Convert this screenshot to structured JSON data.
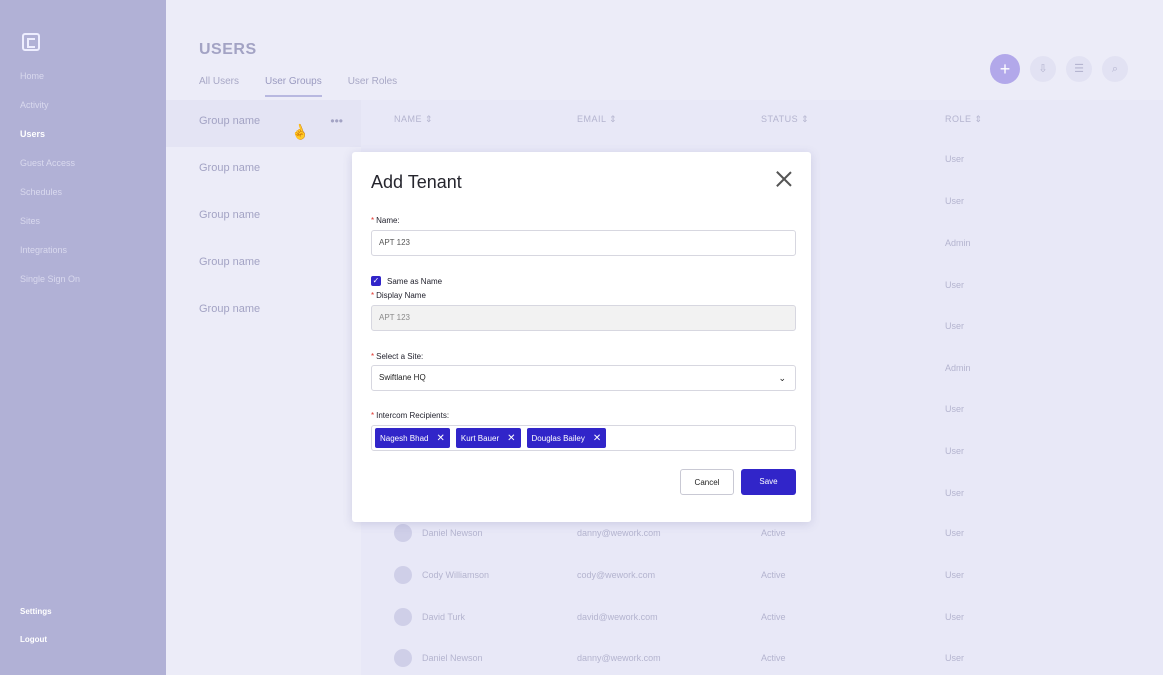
{
  "sidebar": {
    "items": [
      {
        "label": "Home"
      },
      {
        "label": "Activity"
      },
      {
        "label": "Users"
      },
      {
        "label": "Guest Access"
      },
      {
        "label": "Schedules"
      },
      {
        "label": "Sites"
      },
      {
        "label": "Integrations"
      },
      {
        "label": "Single Sign On"
      }
    ],
    "bottom": [
      {
        "label": "Settings"
      },
      {
        "label": "Logout"
      }
    ]
  },
  "page": {
    "title": "USERS",
    "tabs": [
      {
        "label": "All Users"
      },
      {
        "label": "User Groups"
      },
      {
        "label": "User Roles"
      }
    ],
    "actions": {
      "add": "+",
      "download": "⇩",
      "grid": "☰",
      "search": "⌕"
    }
  },
  "groups": [
    {
      "label": "Group name",
      "menu": "•••"
    },
    {
      "label": "Group name"
    },
    {
      "label": "Group name"
    },
    {
      "label": "Group name"
    },
    {
      "label": "Group name"
    }
  ],
  "table": {
    "headers": {
      "name": "NAME ⇕",
      "email": "EMAIL ⇕",
      "status": "STATUS ⇕",
      "role": "ROLE ⇕"
    },
    "roles": [
      "User",
      "User",
      "Admin",
      "User",
      "User",
      "Admin",
      "User",
      "User",
      "User"
    ],
    "rows": [
      {
        "name": "Daniel Newson",
        "email": "danny@wework.com",
        "status": "Active",
        "role": "User"
      },
      {
        "name": "Cody Williamson",
        "email": "cody@wework.com",
        "status": "Active",
        "role": "User"
      },
      {
        "name": "David Turk",
        "email": "david@wework.com",
        "status": "Active",
        "role": "User"
      },
      {
        "name": "Daniel Newson",
        "email": "danny@wework.com",
        "status": "Active",
        "role": "User"
      }
    ]
  },
  "modal": {
    "title": "Add Tenant",
    "name_label": "Name:",
    "name_value": "APT 123",
    "same_as_name_label": "Same as Name",
    "display_name_label": "Display Name",
    "display_name_value": "APT 123",
    "site_label": "Select a Site:",
    "site_value": "Swiftlane HQ",
    "recipients_label": "Intercom Recipients:",
    "recipients": [
      "Nagesh Bhad",
      "Kurt Bauer",
      "Douglas Bailey"
    ],
    "required_mark": "*",
    "cancel_label": "Cancel",
    "save_label": "Save"
  },
  "colors": {
    "accent": "#3125c9",
    "required": "#e0362f"
  }
}
